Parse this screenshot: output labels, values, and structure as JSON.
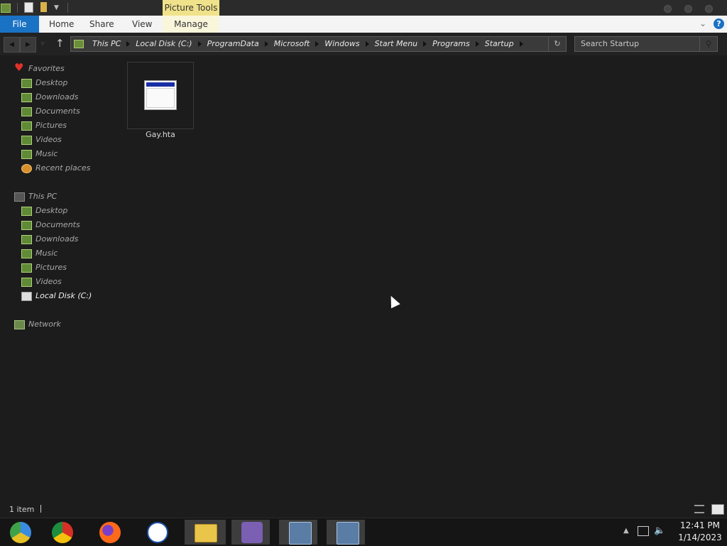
{
  "window": {
    "contextual_tab_group": "Picture Tools"
  },
  "ribbon": {
    "tabs": [
      {
        "label": "File"
      },
      {
        "label": "Home"
      },
      {
        "label": "Share"
      },
      {
        "label": "View"
      },
      {
        "label": "Manage"
      }
    ],
    "help_icon": "?"
  },
  "address": {
    "path": [
      "This PC",
      "Local Disk (C:)",
      "ProgramData",
      "Microsoft",
      "Windows",
      "Start Menu",
      "Programs",
      "Startup"
    ]
  },
  "search": {
    "placeholder": "Search Startup"
  },
  "nav_pane": {
    "favorites": {
      "label": "Favorites",
      "items": [
        "Desktop",
        "Downloads",
        "Documents",
        "Pictures",
        "Videos",
        "Music",
        "Recent places"
      ]
    },
    "this_pc": {
      "label": "This PC",
      "items": [
        "Desktop",
        "Documents",
        "Downloads",
        "Music",
        "Pictures",
        "Videos",
        "Local Disk (C:)"
      ]
    },
    "network": {
      "label": "Network"
    }
  },
  "files": [
    {
      "name": "Gay.hta",
      "icon": "hta-application-icon"
    }
  ],
  "status": {
    "item_count": "1 item"
  },
  "taskbar": {
    "apps": [
      "chromium-icon",
      "chrome-icon",
      "firefox-icon",
      "obama-logo-icon",
      "file-explorer-icon",
      "msn-messenger-icon",
      "setup-icon",
      "setup-icon"
    ],
    "clock_time": "12:41 PM",
    "clock_date": "1/14/2023"
  },
  "colors": {
    "accent": "#1a72c4",
    "contextual_tab": "#f0e28a",
    "background": "#1c1c1c"
  }
}
